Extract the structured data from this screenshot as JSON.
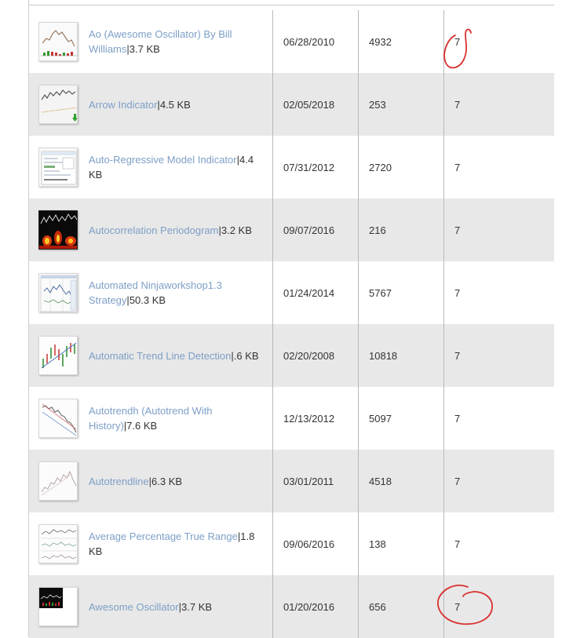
{
  "rows": [
    {
      "name": "Ao (Awesome Oscillator) By Bill Williams",
      "size": "3.7 KB",
      "date": "06/28/2010",
      "downloads": "4932",
      "rating": "7",
      "thumb": "candles-green-red-bars"
    },
    {
      "name": "Arrow Indicator",
      "size": "4.5 KB",
      "date": "02/05/2018",
      "downloads": "253",
      "rating": "7",
      "thumb": "candles-arrow"
    },
    {
      "name": "Auto-Regressive Model Indicator",
      "size": "4.4 KB",
      "date": "07/31/2012",
      "downloads": "2720",
      "rating": "7",
      "thumb": "settings-dialog"
    },
    {
      "name": "Autocorrelation Periodogram",
      "size": "3.2 KB",
      "date": "09/07/2016",
      "downloads": "216",
      "rating": "7",
      "thumb": "heatmap-dark"
    },
    {
      "name": "Automated Ninjaworkshop1.3 Strategy",
      "size": "50.3 KB",
      "date": "01/24/2014",
      "downloads": "5767",
      "rating": "7",
      "thumb": "strategy-chart"
    },
    {
      "name": "Automatic Trend Line Detection",
      "size": ".6 KB",
      "date": "02/20/2008",
      "downloads": "10818",
      "rating": "7",
      "thumb": "candles-trendline"
    },
    {
      "name": "Autotrendh (Autotrend With History)",
      "size": "7.6 KB",
      "date": "12/13/2012",
      "downloads": "5097",
      "rating": "7",
      "thumb": "candles-down"
    },
    {
      "name": "Autotrendline",
      "size": "6.3 KB",
      "date": "03/01/2011",
      "downloads": "4518",
      "rating": "7",
      "thumb": "line-chart-light"
    },
    {
      "name": "Average Percentage True Range",
      "size": "1.8 KB",
      "date": "09/06/2016",
      "downloads": "138",
      "rating": "7",
      "thumb": "multi-panel-chart"
    },
    {
      "name": "Awesome Oscillator",
      "size": "3.7 KB",
      "date": "01/20/2016",
      "downloads": "656",
      "rating": "7",
      "thumb": "dark-oscillator"
    }
  ],
  "separator": "|",
  "colors": {
    "link": "#7d9fc7",
    "row_alt": "#e8e8e8",
    "annotation": "#d93030"
  }
}
